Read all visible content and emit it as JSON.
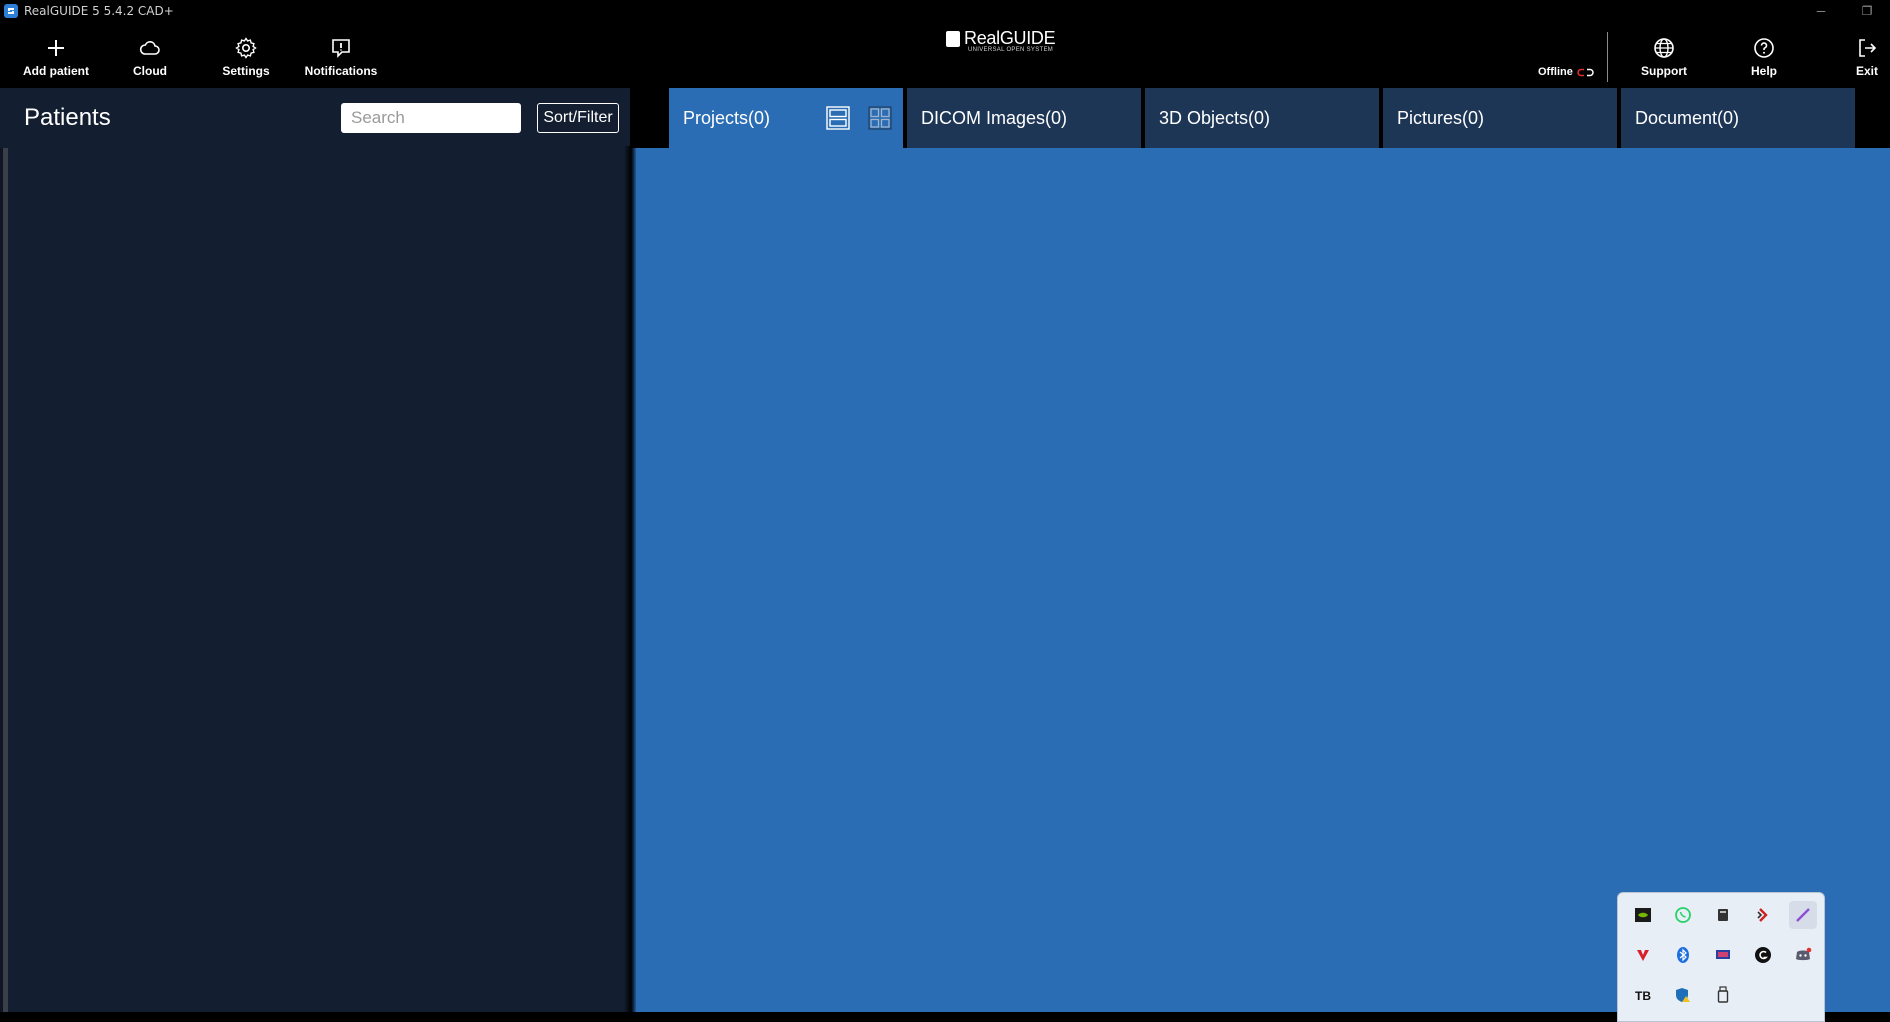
{
  "window": {
    "title": "RealGUIDE 5  5.4.2  CAD+",
    "minimize": "─",
    "restore": "❐"
  },
  "toolbar": {
    "add_patient": "Add patient",
    "cloud": "Cloud",
    "settings": "Settings",
    "notifications": "Notifications",
    "support": "Support",
    "help": "Help",
    "exit": "Exit",
    "status": "Offline"
  },
  "logo": {
    "name": "RealGUIDE",
    "tagline": "UNIVERSAL OPEN SYSTEM"
  },
  "patients": {
    "title": "Patients",
    "search_placeholder": "Search",
    "sort_filter": "Sort/Filter"
  },
  "tabs": [
    {
      "label": "Projects(0)",
      "active": true
    },
    {
      "label": "DICOM Images(0)",
      "active": false
    },
    {
      "label": "3D Objects(0)",
      "active": false
    },
    {
      "label": "Pictures(0)",
      "active": false
    },
    {
      "label": "Document(0)",
      "active": false
    }
  ],
  "tray": {
    "icons": [
      "nvidia-icon",
      "whatsapp-icon",
      "usb-drive-icon",
      "remote-icon",
      "pen-icon",
      "vivaldi-icon",
      "bluetooth-icon",
      "monitor-icon",
      "logitech-icon",
      "discord-icon",
      "tb-icon",
      "defender-icon",
      "usb-stick-icon"
    ]
  },
  "colors": {
    "panel": "#131e30",
    "main": "#2a6db4",
    "tab_inactive": "#1e3656",
    "tab_active": "#2a6db4"
  }
}
